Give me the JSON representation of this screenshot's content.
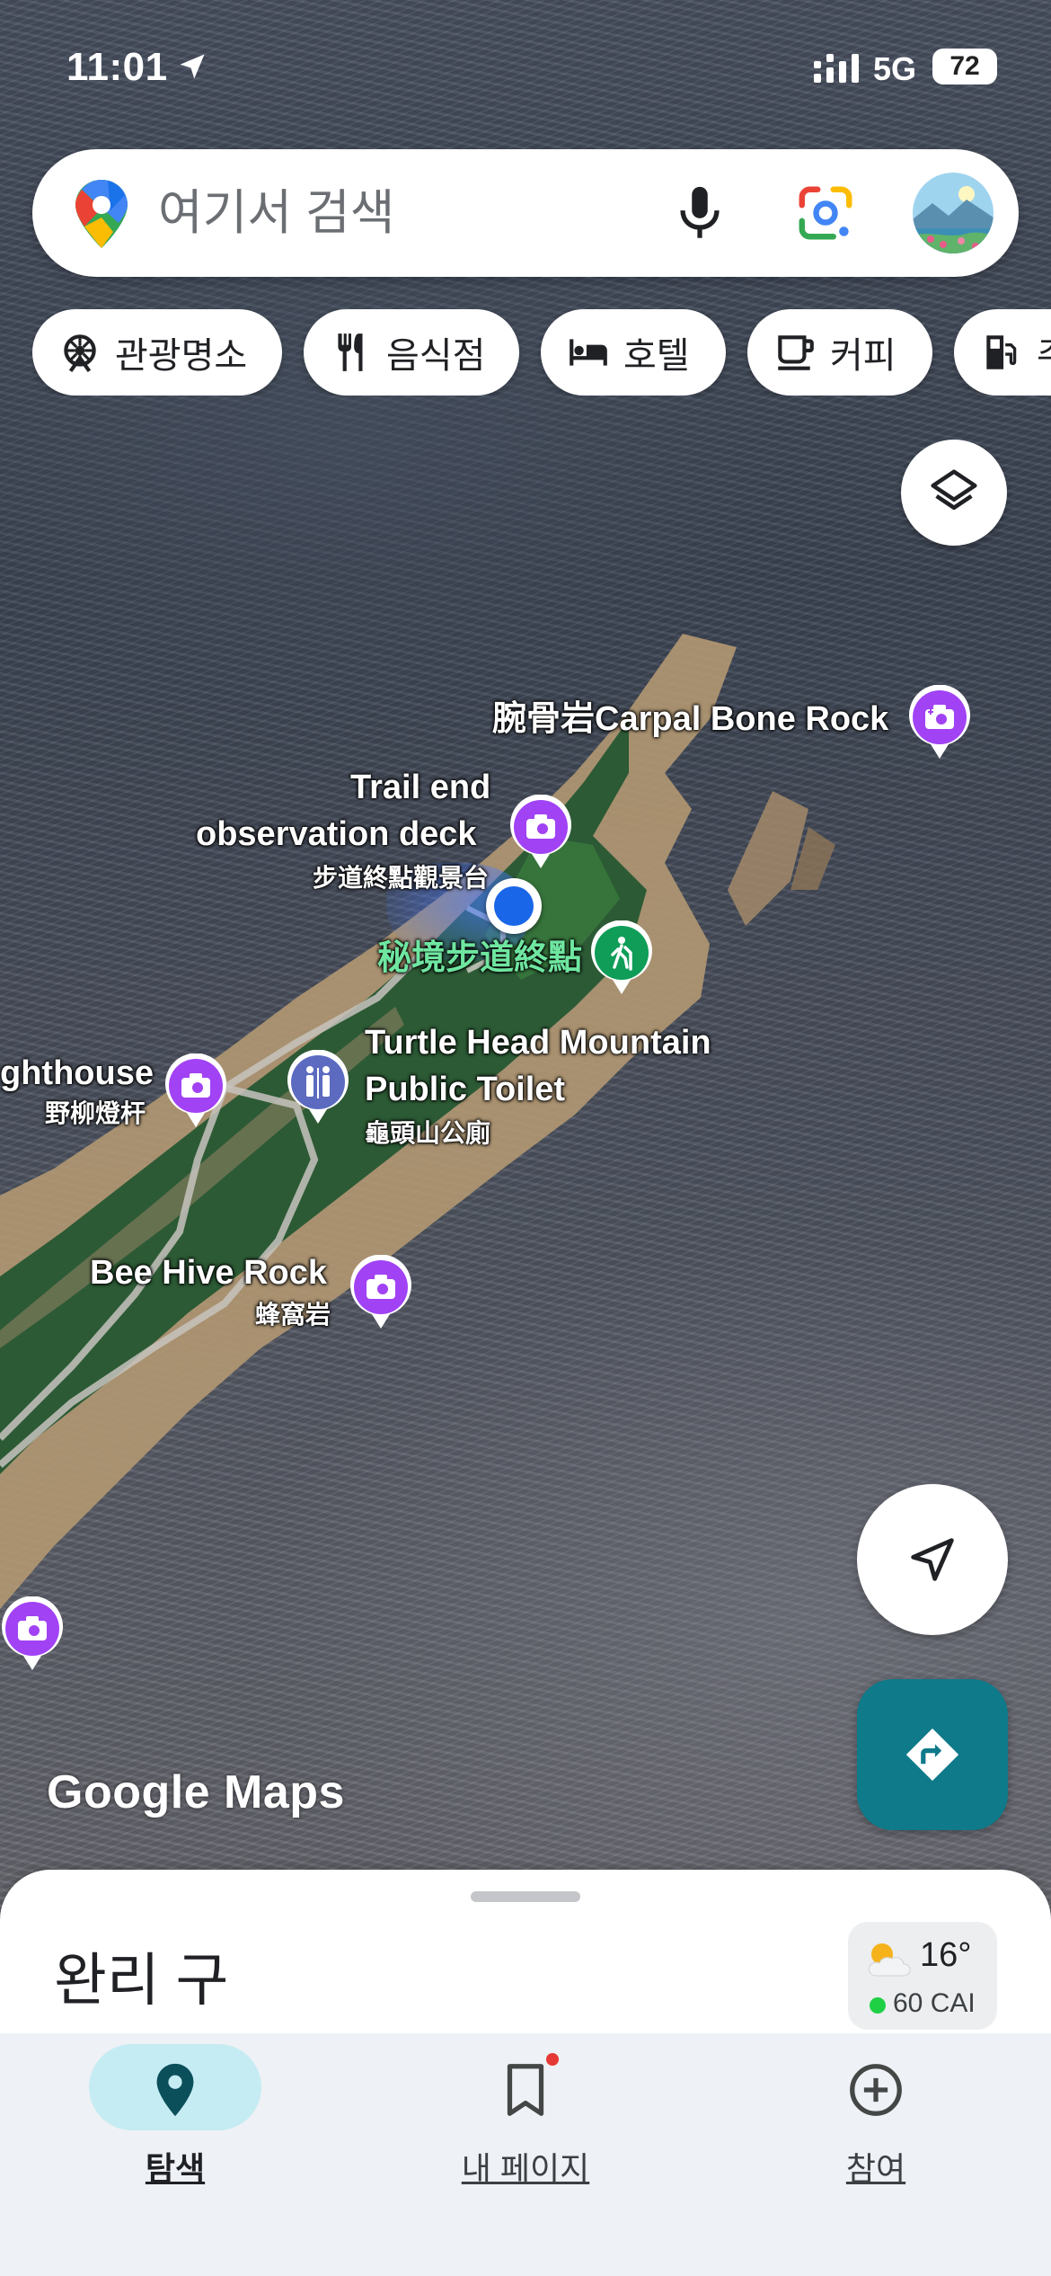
{
  "status_bar": {
    "time": "11:01",
    "network": "5G",
    "battery": "72"
  },
  "search": {
    "placeholder": "여기서 검색"
  },
  "chips": [
    {
      "label": "관광명소",
      "icon": "attraction-icon"
    },
    {
      "label": "음식점",
      "icon": "restaurant-icon"
    },
    {
      "label": "호텔",
      "icon": "hotel-icon"
    },
    {
      "label": "커피",
      "icon": "coffee-icon"
    },
    {
      "label": "주",
      "icon": "gas-station-icon"
    }
  ],
  "map": {
    "watermark": "Google Maps",
    "places": [
      {
        "name": "腕骨岩Carpal Bone Rock"
      },
      {
        "name_line1": "Trail end",
        "name_line2": "observation deck",
        "name_local": "步道終點觀景台"
      },
      {
        "name": "秘境步道終點"
      },
      {
        "name_line1": "ghthouse",
        "name_local": "野柳燈杆"
      },
      {
        "name_line1": "Turtle Head Mountain",
        "name_line2": "Public Toilet",
        "name_local": "龜頭山公廁"
      },
      {
        "name_line1": "Bee Hive Rock",
        "name_local": "蜂窩岩"
      }
    ],
    "pin_colors": {
      "attraction": "#a142f4",
      "hiking": "#0f9d58",
      "amenity": "#5c6bc0"
    }
  },
  "sheet": {
    "title": "완리 구",
    "weather": {
      "temperature": "16°",
      "aqi": "60 CAI"
    }
  },
  "nav": [
    {
      "label": "탐색",
      "icon": "explore-pin-icon",
      "active": true
    },
    {
      "label": "내 페이지",
      "icon": "bookmark-icon",
      "active": false
    },
    {
      "label": "참여",
      "icon": "add-circle-icon",
      "active": false
    }
  ],
  "colors": {
    "accent": "#0e7a8a",
    "nav_active": "#c6ecf3",
    "location_blue": "#1a66e8"
  }
}
